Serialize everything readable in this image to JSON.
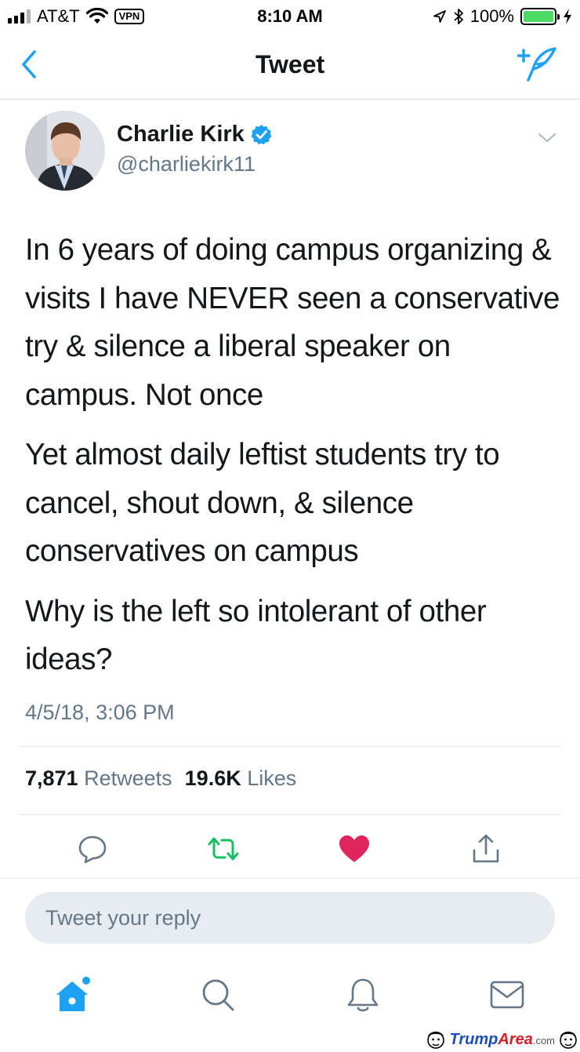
{
  "status_bar": {
    "carrier": "AT&T",
    "vpn": "VPN",
    "time": "8:10 AM",
    "battery": "100%",
    "battery_level": 1.0
  },
  "nav": {
    "title": "Tweet"
  },
  "tweet": {
    "author_name": "Charlie Kirk",
    "author_handle": "@charliekirk11",
    "verified": true,
    "paragraphs": [
      "In 6 years of doing campus organizing & visits I have NEVER seen a conservative try & silence a liberal speaker on campus. Not once",
      "Yet almost daily leftist students try to cancel, shout down, & silence conservatives on campus",
      "Why is the left so intolerant of other ideas?"
    ],
    "timestamp": "4/5/18, 3:06 PM",
    "retweet_count": "7,871",
    "retweet_label": "Retweets",
    "like_count": "19.6K",
    "like_label": "Likes"
  },
  "reply": {
    "placeholder": "Tweet your reply"
  },
  "watermark": {
    "part1": "Trump",
    "part2": "Area",
    "part3": ".com"
  },
  "colors": {
    "accent": "#1da1f2",
    "retweet": "#17bf63",
    "like": "#e0245e",
    "secondary_text": "#657786"
  },
  "icons": [
    "back-chevron-icon",
    "compose-tweet-icon",
    "verified-badge-icon",
    "dropdown-caret-icon",
    "reply-icon",
    "retweet-icon",
    "like-heart-icon",
    "share-icon",
    "home-icon",
    "search-icon",
    "notifications-bell-icon",
    "messages-envelope-icon"
  ]
}
